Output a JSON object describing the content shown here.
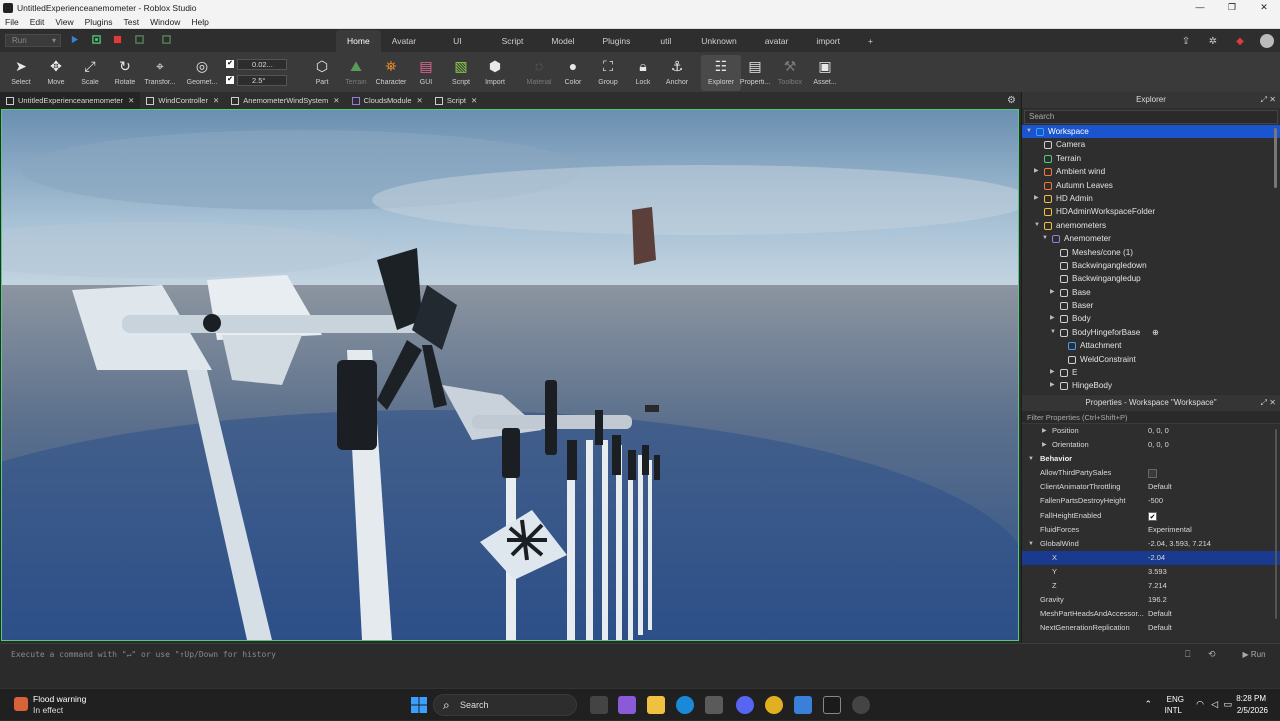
{
  "window": {
    "title": "UntitledExperienceanemometer - Roblox Studio",
    "buttons": [
      "—",
      "❐",
      "✕"
    ]
  },
  "menu": [
    "File",
    "Edit",
    "View",
    "Plugins",
    "Test",
    "Window",
    "Help"
  ],
  "run_select": "Run",
  "ribbon_tabs": [
    "Home",
    "Avatar",
    "UI",
    "Script",
    "Model",
    "Plugins",
    "util",
    "Unknown",
    "avatar",
    "import",
    "+"
  ],
  "tools": {
    "select": "Select",
    "move": "Move",
    "scale": "Scale",
    "rotate": "Rotate",
    "transform": "Transfor...",
    "geometry": "Geomet...",
    "part": "Part",
    "terrain": "Terrain",
    "character": "Character",
    "gui": "GUI",
    "script": "Script",
    "import": "Import",
    "material": "Material",
    "color": "Color",
    "group": "Group",
    "lock": "Lock",
    "anchor": "Anchor",
    "explorer": "Explorer",
    "properties": "Properti...",
    "toolbox": "Toolbox",
    "assets": "Asset..."
  },
  "snap": {
    "move": "0.02...",
    "rotate": "2.5°"
  },
  "doc_tabs": [
    "UntitledExperienceanemometer",
    "WindController",
    "AnemometerWindSystem",
    "CloudsModule",
    "Script"
  ],
  "explorer": {
    "title": "Explorer",
    "search_placeholder": "Search",
    "items": [
      {
        "label": "Workspace",
        "depth": 0,
        "arrow": "▼",
        "icon": "workspace-icon",
        "color": "#3aa0ff",
        "selected": true
      },
      {
        "label": "Camera",
        "depth": 1,
        "arrow": "",
        "icon": "camera-icon",
        "color": "#cfcfcf"
      },
      {
        "label": "Terrain",
        "depth": 1,
        "arrow": "",
        "icon": "terrain-icon",
        "color": "#4fce7a"
      },
      {
        "label": "Ambient wind",
        "depth": 1,
        "arrow": "▶",
        "icon": "sound-icon",
        "color": "#f07a3a"
      },
      {
        "label": "Autumn Leaves",
        "depth": 1,
        "arrow": "",
        "icon": "sound-icon",
        "color": "#f07a3a"
      },
      {
        "label": "HD Admin",
        "depth": 1,
        "arrow": "▶",
        "icon": "folder-icon",
        "color": "#f0c040"
      },
      {
        "label": "HDAdminWorkspaceFolder",
        "depth": 1,
        "arrow": "",
        "icon": "folder-icon",
        "color": "#f0c040"
      },
      {
        "label": "anemometers",
        "depth": 1,
        "arrow": "▼",
        "icon": "folder-icon",
        "color": "#f0c040"
      },
      {
        "label": "Anemometer",
        "depth": 2,
        "arrow": "▼",
        "icon": "model-icon",
        "color": "#9a7ad8"
      },
      {
        "label": "Meshes/cone (1)",
        "depth": 3,
        "arrow": "",
        "icon": "meshpart-icon",
        "color": "#cfcfcf"
      },
      {
        "label": "Backwingangledown",
        "depth": 3,
        "arrow": "",
        "icon": "meshpart-icon",
        "color": "#cfcfcf"
      },
      {
        "label": "Backwingangledup",
        "depth": 3,
        "arrow": "",
        "icon": "meshpart-icon",
        "color": "#cfcfcf"
      },
      {
        "label": "Base",
        "depth": 3,
        "arrow": "▶",
        "icon": "meshpart-icon",
        "color": "#cfcfcf"
      },
      {
        "label": "Baser",
        "depth": 3,
        "arrow": "",
        "icon": "meshpart-icon",
        "color": "#cfcfcf"
      },
      {
        "label": "Body",
        "depth": 3,
        "arrow": "▶",
        "icon": "meshpart-icon",
        "color": "#cfcfcf"
      },
      {
        "label": "BodyHingeforBase",
        "depth": 3,
        "arrow": "▼",
        "icon": "meshpart-icon",
        "color": "#cfcfcf",
        "add": "⊕"
      },
      {
        "label": "Attachment",
        "depth": 4,
        "arrow": "",
        "icon": "attachment-icon",
        "color": "#3aa0ff"
      },
      {
        "label": "WeldConstraint",
        "depth": 4,
        "arrow": "",
        "icon": "weld-icon",
        "color": "#cfcfcf"
      },
      {
        "label": "E",
        "depth": 3,
        "arrow": "▶",
        "icon": "meshpart-icon",
        "color": "#cfcfcf"
      },
      {
        "label": "HingeBody",
        "depth": 3,
        "arrow": "▶",
        "icon": "meshpart-icon",
        "color": "#cfcfcf"
      }
    ]
  },
  "properties": {
    "title": "Properties - Workspace \"Workspace\"",
    "filter_placeholder": "Filter Properties (Ctrl+Shift+P)",
    "rows": [
      {
        "kind": "prop",
        "arrow": "▶",
        "name": "Position",
        "value": "0, 0, 0"
      },
      {
        "kind": "prop",
        "arrow": "▶",
        "name": "Orientation",
        "value": "0, 0, 0"
      },
      {
        "kind": "cat",
        "arrow": "▼",
        "name": "Behavior",
        "value": ""
      },
      {
        "kind": "check",
        "name": "AllowThirdPartySales",
        "checked": false
      },
      {
        "kind": "prop",
        "name": "ClientAnimatorThrottling",
        "value": "Default"
      },
      {
        "kind": "prop",
        "name": "FallenPartsDestroyHeight",
        "value": "-500"
      },
      {
        "kind": "check",
        "name": "FallHeightEnabled",
        "checked": true
      },
      {
        "kind": "prop",
        "name": "FluidForces",
        "value": "Experimental"
      },
      {
        "kind": "prop",
        "arrow": "▼",
        "name": "GlobalWind",
        "value": "-2.04, 3.593, 7.214",
        "topArrow": true
      },
      {
        "kind": "sub",
        "name": "X",
        "value": "-2.04",
        "selected": true
      },
      {
        "kind": "sub",
        "name": "Y",
        "value": "3.593"
      },
      {
        "kind": "sub",
        "name": "Z",
        "value": "7.214"
      },
      {
        "kind": "prop",
        "name": "Gravity",
        "value": "196.2"
      },
      {
        "kind": "prop",
        "name": "MeshPartHeadsAndAccessor...",
        "value": "Default"
      },
      {
        "kind": "prop",
        "name": "NextGenerationReplication",
        "value": "Default"
      }
    ]
  },
  "command_bar": {
    "placeholder": "Execute a command with \"↵\" or use \"↑Up/Down for history",
    "run_label": "▶ Run"
  },
  "taskbar": {
    "weather_title": "Flood warning",
    "weather_sub": "In effect",
    "search_label": "Search",
    "lang_top": "ENG",
    "lang_bottom": "INTL",
    "time": "8:28 PM",
    "date": "2/5/2026"
  },
  "colors": {
    "accent": "#1a55cf",
    "viewport_border": "#4fce7a",
    "toolbar_bg": "#3a3a3a"
  }
}
